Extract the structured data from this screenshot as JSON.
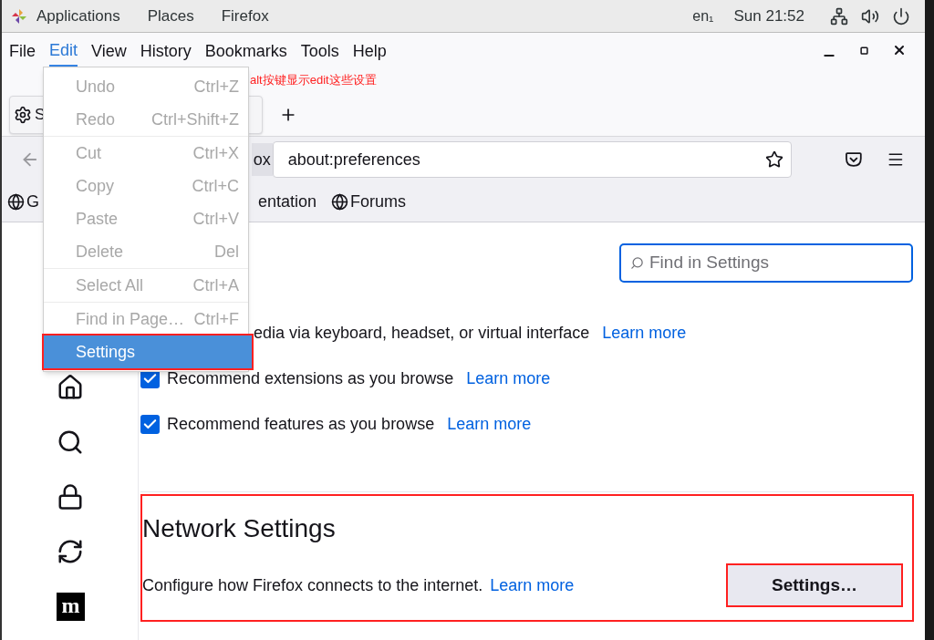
{
  "top_bar": {
    "menus": [
      "Applications",
      "Places",
      "Firefox"
    ],
    "input_source": "en₁",
    "clock": "Sun 21:52"
  },
  "menu_bar": [
    {
      "label": "File",
      "selected": false
    },
    {
      "label": "Edit",
      "selected": true
    },
    {
      "label": "View",
      "selected": false
    },
    {
      "label": "History",
      "selected": false
    },
    {
      "label": "Bookmarks",
      "selected": false
    },
    {
      "label": "Tools",
      "selected": false
    },
    {
      "label": "Help",
      "selected": false
    }
  ],
  "annotation_note": "alt按键显示edit这些设置",
  "tab": {
    "label": "S"
  },
  "url_bar": {
    "identity": "ox",
    "url": "about:preferences"
  },
  "bookmarks": [
    {
      "label": "G",
      "icon": true
    },
    {
      "label": "entation",
      "icon": false
    },
    {
      "label": "Forums",
      "icon": true
    }
  ],
  "edit_menu": [
    {
      "label": "Undo",
      "shortcut": "Ctrl+Z",
      "disabled": true,
      "selected": false,
      "annotated": false,
      "separator_after": false
    },
    {
      "label": "Redo",
      "shortcut": "Ctrl+Shift+Z",
      "disabled": true,
      "selected": false,
      "annotated": false,
      "separator_after": true
    },
    {
      "label": "Cut",
      "shortcut": "Ctrl+X",
      "disabled": true,
      "selected": false,
      "annotated": false,
      "separator_after": false
    },
    {
      "label": "Copy",
      "shortcut": "Ctrl+C",
      "disabled": true,
      "selected": false,
      "annotated": false,
      "separator_after": false
    },
    {
      "label": "Paste",
      "shortcut": "Ctrl+V",
      "disabled": true,
      "selected": false,
      "annotated": false,
      "separator_after": false
    },
    {
      "label": "Delete",
      "shortcut": "Del",
      "disabled": true,
      "selected": false,
      "annotated": false,
      "separator_after": true
    },
    {
      "label": "Select All",
      "shortcut": "Ctrl+A",
      "disabled": true,
      "selected": false,
      "annotated": false,
      "separator_after": true
    },
    {
      "label": "Find in Page…",
      "shortcut": "Ctrl+F",
      "disabled": true,
      "selected": false,
      "annotated": false,
      "separator_after": false
    },
    {
      "label": "Settings",
      "disabled": false,
      "selected": true,
      "annotated": true,
      "separator_after": false
    }
  ],
  "sidebar": {
    "logo_letter": "m"
  },
  "search": {
    "placeholder": "Find in Settings"
  },
  "options": [
    {
      "kind": "text",
      "label": "edia via keyboard, headset, or virtual interface",
      "link": "Learn more"
    },
    {
      "kind": "checkbox",
      "label": "Recommend extensions as you browse",
      "checked": true,
      "link": "Learn more"
    },
    {
      "kind": "checkbox",
      "label": "Recommend features as you browse",
      "checked": true,
      "link": "Learn more"
    }
  ],
  "network": {
    "title": "Network Settings",
    "description": "Configure how Firefox connects to the internet.",
    "link": "Learn more",
    "button": "Settings…",
    "annotated": true,
    "button_annotated": true
  }
}
